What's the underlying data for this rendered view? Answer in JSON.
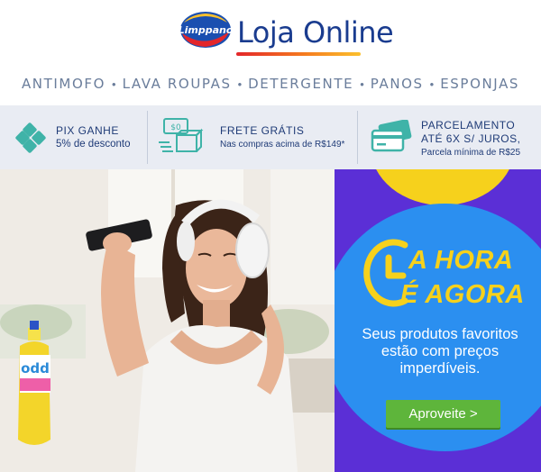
{
  "header": {
    "brand_badge": "Limppano",
    "store_title": "Loja Online"
  },
  "categories": [
    "ANTIMOFO",
    "LAVA ROUPAS",
    "DETERGENTE",
    "PANOS",
    "ESPONJAS"
  ],
  "category_separator": "•",
  "benefits": [
    {
      "icon": "pix-icon",
      "title": "PIX GANHE",
      "subtitle": "5% de desconto"
    },
    {
      "icon": "shipping-box-icon",
      "title": "FRETE GRÁTIS",
      "subtitle": "Nas compras acima de R$149*"
    },
    {
      "icon": "credit-cards-icon",
      "title_line1": "PARCELAMENTO",
      "title_line2": "ATÉ 6X S/ JUROS,",
      "subtitle": "Parcela mínima de R$25"
    }
  ],
  "shipping_icon_label": "$0",
  "hero": {
    "product_label": "odd",
    "headline_line1": "A HORA",
    "headline_line2": "É AGORA",
    "body_line1": "Seus produtos favoritos",
    "body_line2": "estão com preços",
    "body_line3": "imperdíveis.",
    "cta_label": "Aproveite >"
  },
  "colors": {
    "brand_blue": "#1a3c8f",
    "nav_text": "#6a7d9b",
    "benefit_icon": "#3fb3a8",
    "promo_purple": "#5b2fd6",
    "promo_blue": "#2b8ff0",
    "promo_yellow": "#f6d11c",
    "cta_green": "#5eb53b"
  }
}
